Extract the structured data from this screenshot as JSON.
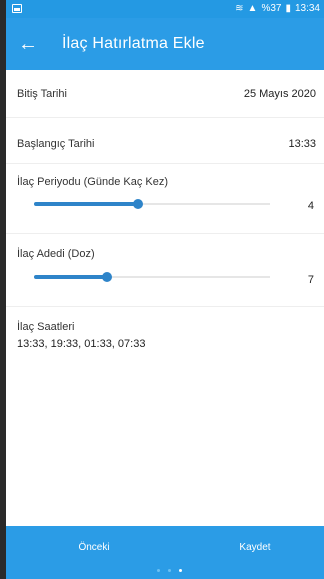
{
  "status_bar": {
    "signal_text": "%37",
    "time": "13:34"
  },
  "app_bar": {
    "back_icon": "arrow-left-icon",
    "title": "İlaç Hatırlatma Ekle"
  },
  "form": {
    "end_date": {
      "label": "Bitiş Tarihi",
      "value": "25 Mayıs 2020"
    },
    "start_time": {
      "label": "Başlangıç Tarihi",
      "value": "13:33"
    },
    "period": {
      "label": "İlaç Periyodu (Günde Kaç Kez)",
      "value": "4",
      "fraction": 0.44
    },
    "dose_count": {
      "label": "İlaç Adedi (Doz)",
      "value": "7",
      "fraction": 0.31
    },
    "times": {
      "label": "İlaç Saatleri",
      "value": "13:33, 19:33, 01:33, 07:33"
    }
  },
  "bottom_bar": {
    "previous": "Önceki",
    "save": "Kaydet",
    "page_indicator": {
      "count": 3,
      "active_index": 2
    }
  },
  "colors": {
    "primary": "#2b9ce6",
    "accent": "#2e84c9"
  }
}
